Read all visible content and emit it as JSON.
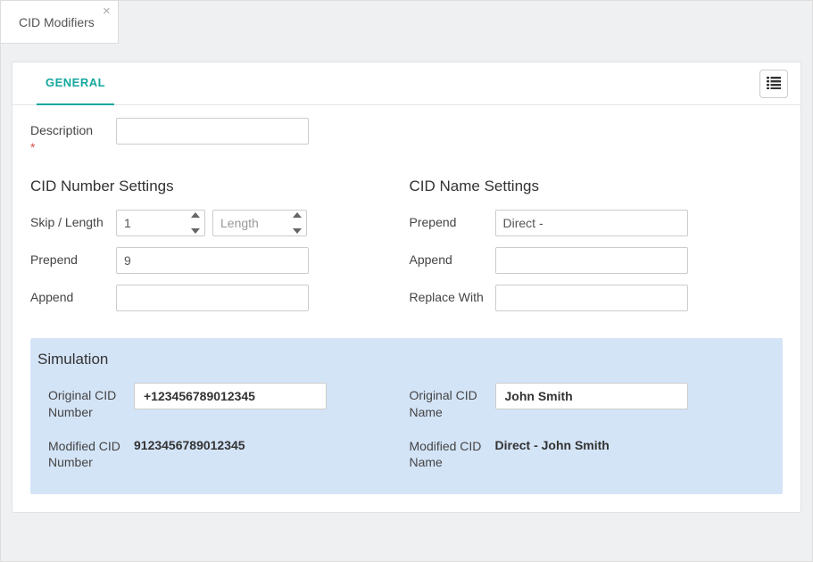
{
  "tab": {
    "title": "CID Modifiers"
  },
  "inner_tab": {
    "general": "GENERAL"
  },
  "description": {
    "label": "Description",
    "value": ""
  },
  "number_settings": {
    "heading": "CID Number Settings",
    "skip_label": "Skip / Length",
    "skip_value": "1",
    "length_placeholder": "Length",
    "prepend_label": "Prepend",
    "prepend_value": "9",
    "append_label": "Append",
    "append_value": ""
  },
  "name_settings": {
    "heading": "CID Name Settings",
    "prepend_label": "Prepend",
    "prepend_value": "Direct - ",
    "append_label": "Append",
    "append_value": "",
    "replace_label": "Replace With",
    "replace_value": ""
  },
  "simulation": {
    "heading": "Simulation",
    "orig_num_label": "Original CID Number",
    "orig_num_value": "+123456789012345",
    "mod_num_label": "Modified CID Number",
    "mod_num_value": "9123456789012345",
    "orig_name_label": "Original CID Name",
    "orig_name_value": "John Smith",
    "mod_name_label": "Modified CID Name",
    "mod_name_value": "Direct - John Smith"
  }
}
